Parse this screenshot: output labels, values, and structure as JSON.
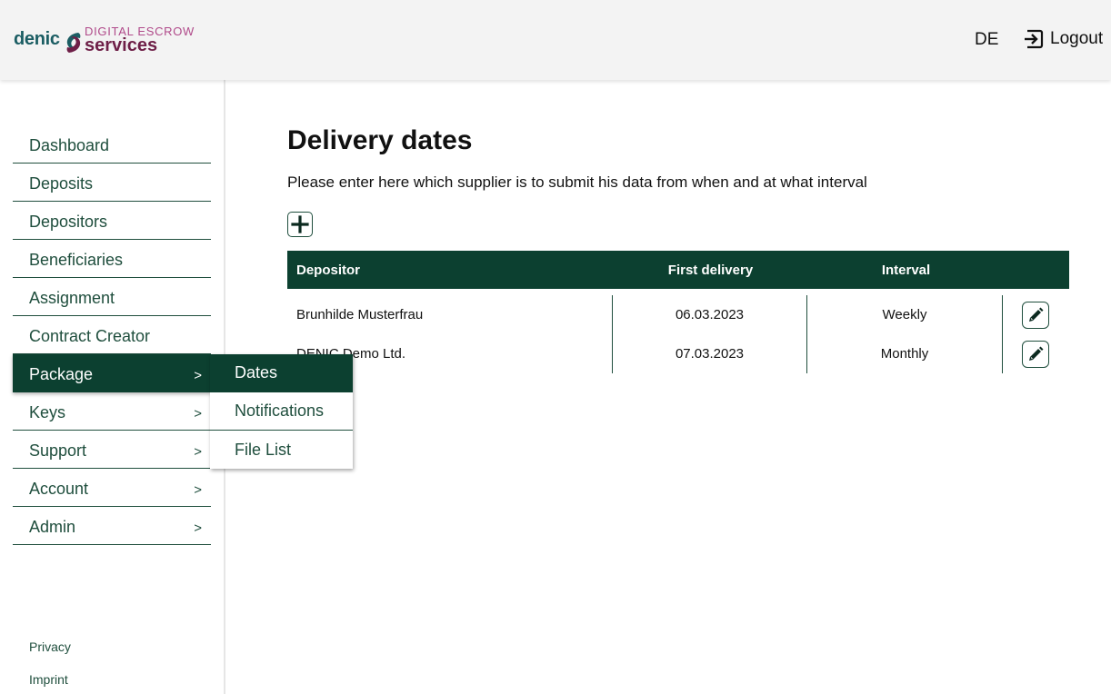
{
  "header": {
    "logo": {
      "brand": "denic",
      "line1": "DIGITAL ESCROW",
      "line2": "services",
      "mark_icon": "denic-swirl-icon"
    },
    "language": "DE",
    "logout_label": "Logout",
    "logout_icon": "sign-out-icon"
  },
  "sidebar": {
    "items": [
      {
        "label": "Dashboard",
        "arrow": ""
      },
      {
        "label": "Deposits",
        "arrow": ""
      },
      {
        "label": "Depositors",
        "arrow": ""
      },
      {
        "label": "Beneficiaries",
        "arrow": ""
      },
      {
        "label": "Assignment",
        "arrow": ""
      },
      {
        "label": "Contract Creator",
        "arrow": ""
      },
      {
        "label": "Package",
        "arrow": ">"
      },
      {
        "label": "Keys",
        "arrow": ">"
      },
      {
        "label": "Support",
        "arrow": ">"
      },
      {
        "label": "Account",
        "arrow": ">"
      },
      {
        "label": "Admin",
        "arrow": ">"
      }
    ],
    "active_item": "Package",
    "footer": {
      "privacy": "Privacy",
      "imprint": "Imprint"
    }
  },
  "submenu": {
    "items": [
      {
        "label": "Dates"
      },
      {
        "label": "Notifications"
      },
      {
        "label": "File List"
      }
    ],
    "active_item": "Dates"
  },
  "main": {
    "title": "Delivery dates",
    "subtitle": "Please enter here which supplier is to submit his data from when and at what interval",
    "add_icon": "plus-icon",
    "table": {
      "columns": [
        "Depositor",
        "First delivery",
        "Interval",
        ""
      ],
      "rows": [
        {
          "depositor": "Brunhilde Musterfrau",
          "first_delivery": "06.03.2023",
          "interval": "Weekly",
          "action_icon": "pencil-icon"
        },
        {
          "depositor": "DENIC Demo Ltd.",
          "first_delivery": "07.03.2023",
          "interval": "Monthly",
          "action_icon": "pencil-icon"
        }
      ]
    }
  },
  "colors": {
    "primary_dark_green": "#0c4030",
    "nav_text_green": "#1f4e3d",
    "header_bg": "#f3f3f3",
    "logo_teal": "#1b5d63",
    "logo_pink": "#b04a8a",
    "logo_plum": "#6e1f47"
  }
}
